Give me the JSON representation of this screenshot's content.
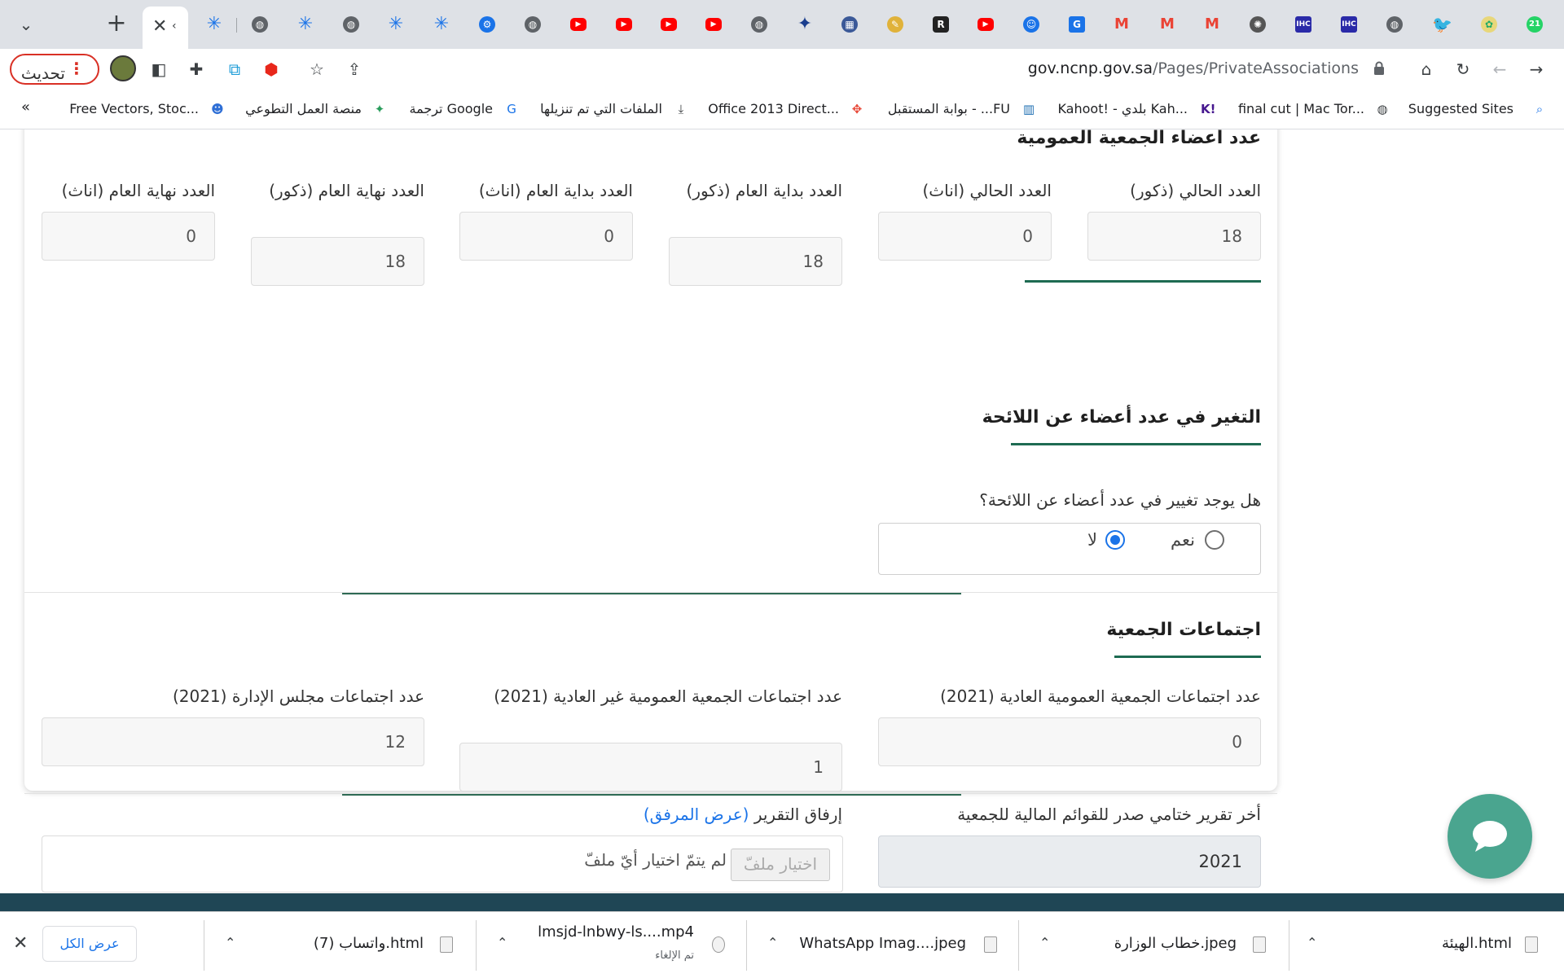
{
  "browser": {
    "tab_badge": "21",
    "reload_label": "تحديث",
    "url_domain": "gov.ncnp.gov.sa",
    "url_path": "/Pages/PrivateAssociations",
    "bookmarks": [
      {
        "label": "Suggested Sites"
      },
      {
        "label": "final cut | Mac Tor..."
      },
      {
        "label": "Kahoot! - بلدي Kah..."
      },
      {
        "label": "بوابة المستقبل - ...FU"
      },
      {
        "label": "Office 2013 Direct..."
      },
      {
        "label": "الملفات التي تم تنزيلها"
      },
      {
        "label": "ترجمة Google"
      },
      {
        "label": "منصة العمل التطوعي"
      },
      {
        "label": "Free Vectors, Stoc..."
      }
    ],
    "bookmarks_overflow": "«"
  },
  "members_section": {
    "title": "عدد أعضاء الجمعية العمومية",
    "fields": [
      {
        "label": "العدد الحالي (ذكور)",
        "value": "18"
      },
      {
        "label": "العدد الحالي (اناث)",
        "value": "0"
      },
      {
        "label": "العدد بداية العام (ذكور)",
        "value": "18"
      },
      {
        "label": "العدد بداية العام (اناث)",
        "value": "0"
      },
      {
        "label": "العدد نهاية العام (ذكور)",
        "value": "18"
      },
      {
        "label": "العدد نهاية العام (اناث)",
        "value": "0"
      }
    ]
  },
  "change_section": {
    "title": "التغير في عدد أعضاء عن اللائحة",
    "question": "هل يوجد تغيير في عدد أعضاء عن اللائحة؟",
    "options": [
      {
        "label": "نعم",
        "selected": false
      },
      {
        "label": "لا",
        "selected": true
      }
    ]
  },
  "meetings_section": {
    "title": "اجتماعات الجمعية",
    "fields": [
      {
        "label": "عدد اجتماعات الجمعية العمومية العادية (2021)",
        "value": "0"
      },
      {
        "label": "عدد اجتماعات الجمعية العمومية غير العادية (2021)",
        "value": "1"
      },
      {
        "label": "عدد اجتماعات مجلس الإدارة (2021)",
        "value": "12"
      }
    ]
  },
  "report_section": {
    "last_report_label": "أخر تقرير ختامي صدر للقوائم المالية للجمعية",
    "last_report_value": "2021",
    "attach_label": "إرفاق التقرير",
    "attach_link": "(عرض المرفق)",
    "choose_file": "اختيار ملفّ",
    "no_file": "لم يتمّ اختيار أيّ ملفّ"
  },
  "downloads": {
    "items": [
      {
        "name": "الهيئة.html",
        "sub": ""
      },
      {
        "name": "خطاب الوزارة.jpeg",
        "sub": ""
      },
      {
        "name": "WhatsApp Imag....jpeg",
        "sub": ""
      },
      {
        "name": "lmsjd-lnbwy-ls....mp4",
        "sub": "تم الإلغاء"
      },
      {
        "name": "واتساب (7).html",
        "sub": ""
      }
    ],
    "show_all": "عرض الكل"
  },
  "colors": {
    "accent_green": "#1e6b52",
    "link_blue": "#1a73e8",
    "chat_fab": "#4aa58f",
    "footer": "#1f4655",
    "reload_red": "#d93025"
  }
}
